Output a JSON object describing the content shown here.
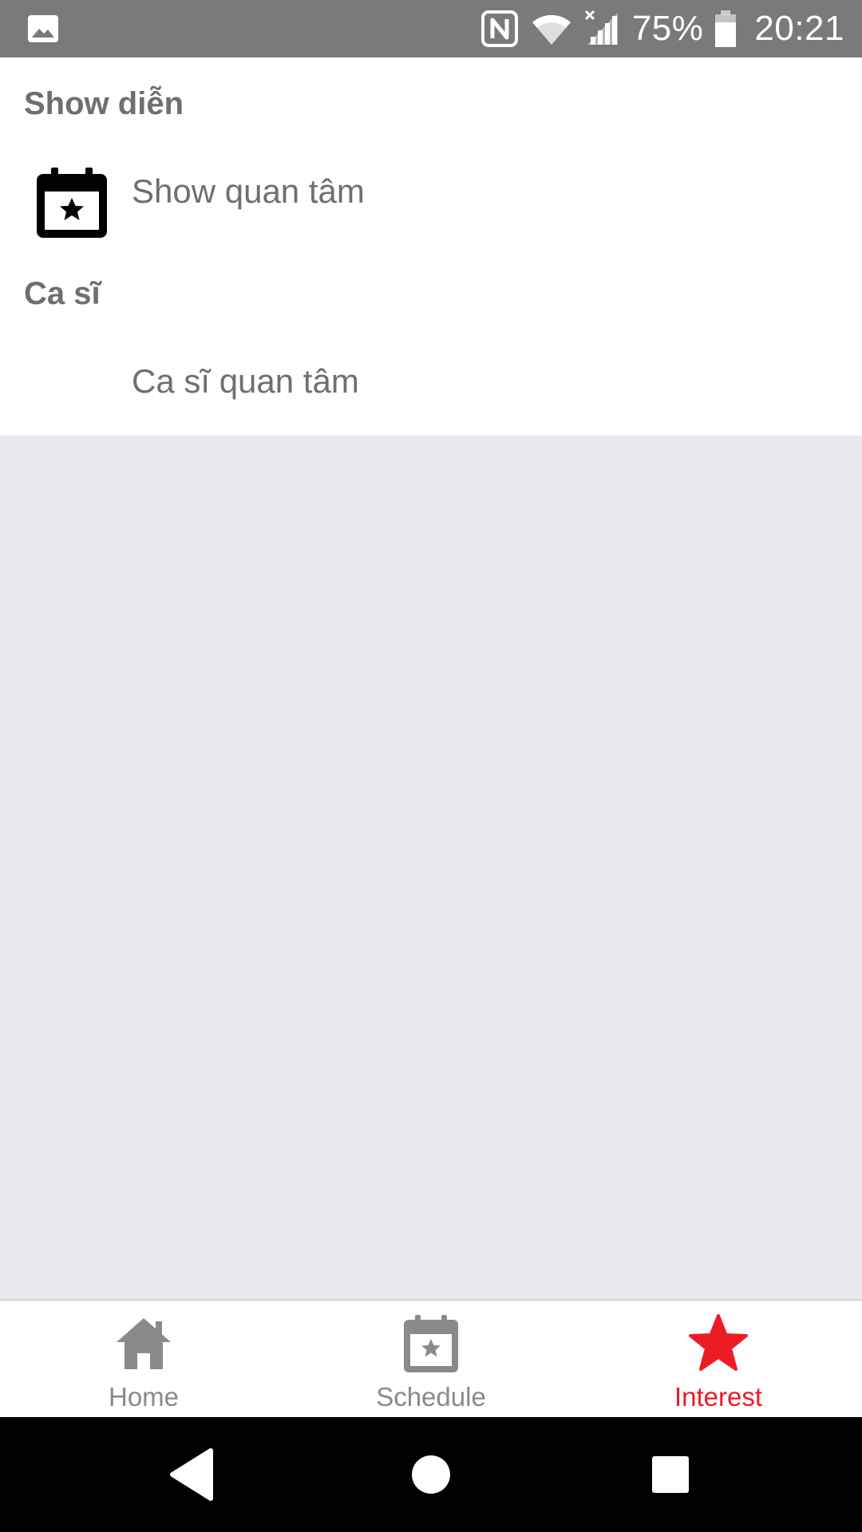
{
  "status_bar": {
    "battery_percent": "75%",
    "time": "20:21",
    "icons": [
      "image-notification-icon",
      "nfc-icon",
      "wifi-icon",
      "signal-icon",
      "battery-icon"
    ]
  },
  "sections": [
    {
      "header": "Show diễn",
      "items": [
        {
          "label": "Show quan tâm",
          "icon": "calendar-star-icon"
        }
      ]
    },
    {
      "header": "Ca sĩ",
      "items": [
        {
          "label": "Ca sĩ quan tâm",
          "icon": ""
        }
      ]
    }
  ],
  "tabs": [
    {
      "label": "Home",
      "icon": "home-icon",
      "active": false
    },
    {
      "label": "Schedule",
      "icon": "calendar-star-icon",
      "active": false
    },
    {
      "label": "Interest",
      "icon": "star-icon",
      "active": true
    }
  ],
  "colors": {
    "active_tab": "#ec1c24",
    "inactive": "#8a8a8a",
    "status_bar": "#7a7a7a",
    "background": "#e8e8ee"
  }
}
